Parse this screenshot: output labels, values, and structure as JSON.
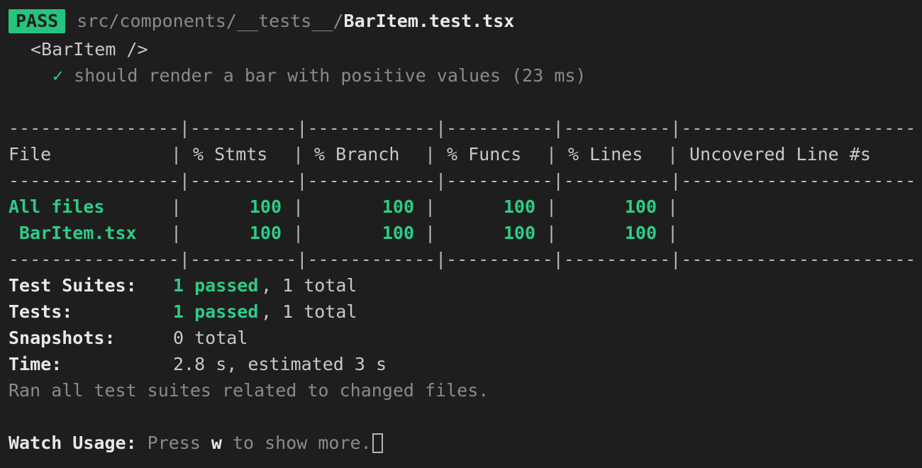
{
  "terminal": {
    "background": "#1e1e1e",
    "foreground": "#c8c8c8",
    "accent_green": "#2ecc87",
    "badge_green": "#25c47e",
    "dim": "#8a8a8a"
  },
  "header": {
    "status_badge": "PASS",
    "test_path_prefix": "src/components/__tests__/",
    "test_file": "BarItem.test.tsx"
  },
  "suite": {
    "describe_block": "<BarItem />",
    "tests": [
      {
        "icon": "check-icon",
        "check": "✓",
        "name": "should render a bar with positive values",
        "duration": "(23 ms)"
      }
    ]
  },
  "coverage_table": {
    "rule": "----------------",
    "rule_stmts": "----------",
    "rule_branch": "------------",
    "rule_funcs": "----------",
    "rule_lines": "----------",
    "rule_uncovered": "----------------------",
    "separator": "|",
    "headers": [
      "File",
      "% Stmts",
      "% Branch",
      "% Funcs",
      "% Lines",
      "Uncovered Line #s"
    ],
    "rows": [
      {
        "file": "All files",
        "indent": 0,
        "stmts": "100",
        "branch": "100",
        "funcs": "100",
        "lines": "100",
        "uncovered": ""
      },
      {
        "file": "BarItem.tsx",
        "indent": 1,
        "stmts": "100",
        "branch": "100",
        "funcs": "100",
        "lines": "100",
        "uncovered": ""
      }
    ]
  },
  "summary": {
    "test_suites": {
      "label": "Test Suites:",
      "passed": "1 passed",
      "rest": ", 1 total"
    },
    "tests": {
      "label": "Tests:",
      "passed": "1 passed",
      "rest": ", 1 total"
    },
    "snapshots": {
      "label": "Snapshots:",
      "value": "0 total"
    },
    "time": {
      "label": "Time:",
      "value": "2.8 s, estimated 3 s"
    },
    "ran_note": "Ran all test suites related to changed files."
  },
  "watch": {
    "label": "Watch Usage:",
    "press": "Press",
    "key": "w",
    "suffix": "to show more."
  }
}
